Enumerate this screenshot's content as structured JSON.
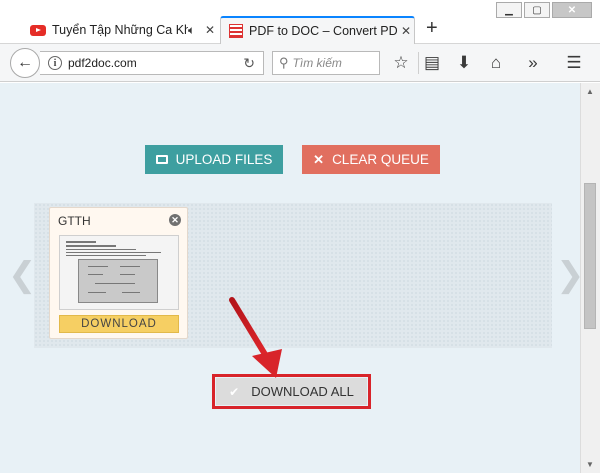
{
  "browser": {
    "tabs": [
      {
        "title": "Tuyển Tập Những Ca Khúc",
        "icon": "youtube-icon",
        "audio": "speaker-icon"
      },
      {
        "title": "PDF to DOC – Convert PDF to",
        "icon": "pdf2doc-favicon"
      }
    ],
    "new_tab": "+",
    "url": "pdf2doc.com",
    "search_placeholder": "Tìm kiếm"
  },
  "page": {
    "upload_label": "UPLOAD FILES",
    "clear_label": "CLEAR QUEUE",
    "file_card": {
      "name": "GTTH",
      "download_label": "DOWNLOAD"
    },
    "download_all_label": "DOWNLOAD ALL",
    "nav_prev": "❮",
    "nav_next": "❯"
  },
  "colors": {
    "upload": "#3e9fa0",
    "clear": "#e16f5f",
    "download": "#f6cf63",
    "highlight": "#d8242a"
  }
}
